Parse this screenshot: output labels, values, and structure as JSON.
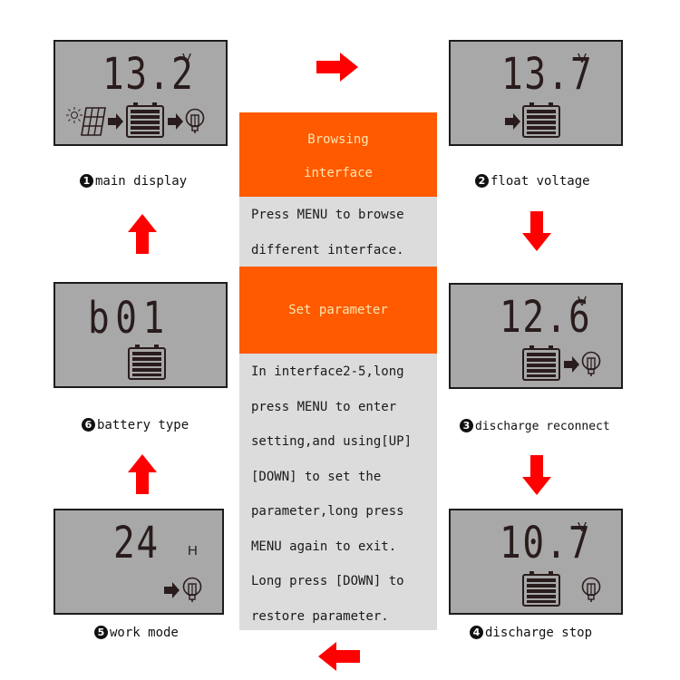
{
  "colors": {
    "accent_orange": "#ff5a00",
    "arrow_red": "#ff0000",
    "lcd_bg": "#a8a8a8",
    "panel_grey": "#dcdcdc",
    "header_text": "#fde6b0"
  },
  "center": {
    "browse_title_line1": "Browsing",
    "browse_title_line2": "interface",
    "browse_text": [
      "Press  MENU  to  browse",
      "different  interface."
    ],
    "set_title": "Set parameter",
    "set_text": [
      "In interface2-5,long",
      "press MENU to enter",
      "setting,and using[UP]",
      "[DOWN] to set the",
      "parameter,long press",
      "MENU again to exit.",
      "Long press [DOWN] to",
      "restore parameter."
    ]
  },
  "screens": [
    {
      "number": "1",
      "badge": "❶",
      "caption": "main display",
      "reading": "13.2",
      "unit": "V",
      "icons": [
        "sun-icon",
        "solar-panel-icon",
        "arrow-icon",
        "battery-icon",
        "arrow-icon",
        "bulb-icon"
      ]
    },
    {
      "number": "2",
      "badge": "❷",
      "caption": "float voltage",
      "reading": "13.7",
      "unit": "V",
      "icons": [
        "arrow-icon",
        "battery-icon"
      ]
    },
    {
      "number": "3",
      "badge": "❸",
      "caption": "discharge reconnect",
      "reading": "12.6",
      "unit": "V",
      "icons": [
        "battery-icon",
        "arrow-icon",
        "bulb-icon"
      ]
    },
    {
      "number": "4",
      "badge": "❹",
      "caption": "discharge stop",
      "reading": "10.7",
      "unit": "V",
      "icons": [
        "battery-icon",
        "bulb-icon"
      ]
    },
    {
      "number": "5",
      "badge": "❺",
      "caption": "work mode",
      "reading": "24",
      "unit": "H",
      "icons": [
        "arrow-icon",
        "bulb-icon"
      ]
    },
    {
      "number": "6",
      "badge": "❻",
      "caption": "battery type",
      "reading": "b01",
      "unit": "",
      "icons": [
        "battery-icon"
      ]
    }
  ],
  "flow_arrows": [
    "right",
    "down",
    "down",
    "left",
    "up",
    "up"
  ]
}
